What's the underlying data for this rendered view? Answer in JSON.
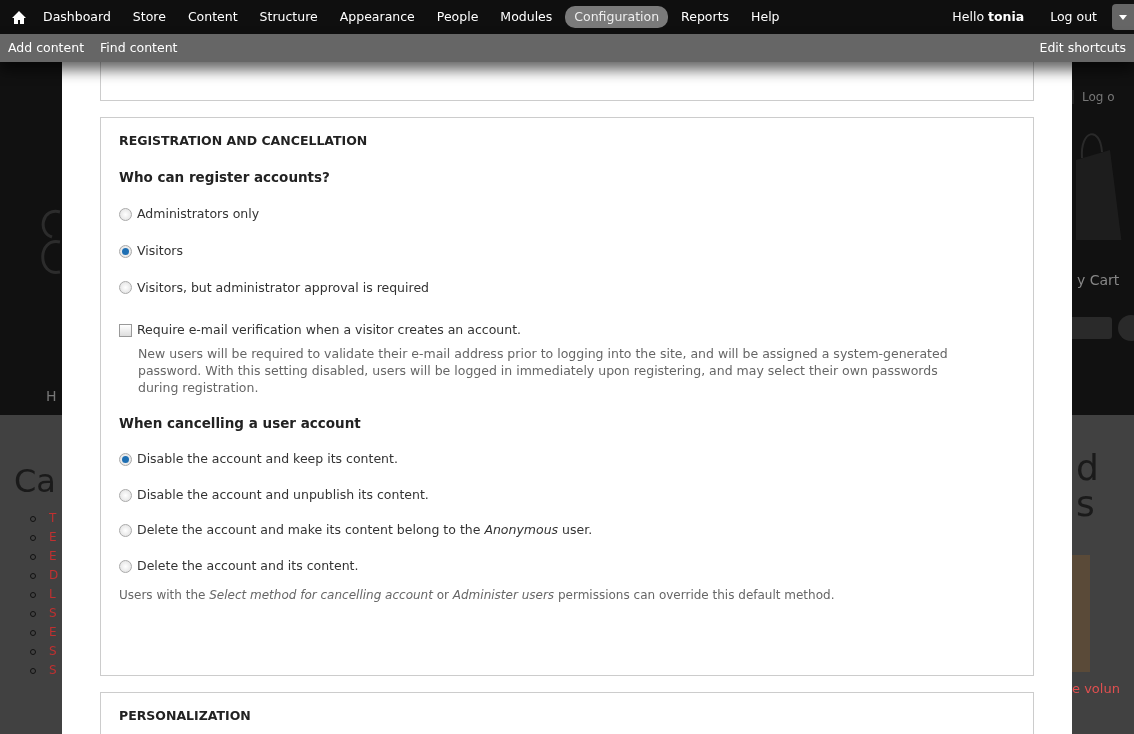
{
  "toolbar": {
    "menu": [
      {
        "label": "Dashboard",
        "selected": false
      },
      {
        "label": "Store",
        "selected": false
      },
      {
        "label": "Content",
        "selected": false
      },
      {
        "label": "Structure",
        "selected": false
      },
      {
        "label": "Appearance",
        "selected": false
      },
      {
        "label": "People",
        "selected": false
      },
      {
        "label": "Modules",
        "selected": false
      },
      {
        "label": "Configuration",
        "selected": true
      },
      {
        "label": "Reports",
        "selected": false
      },
      {
        "label": "Help",
        "selected": false
      }
    ],
    "greeting": "Hello **tonia**",
    "logout": "Log out"
  },
  "shortcuts": {
    "items": [
      "Add content",
      "Find content"
    ],
    "edit": "Edit shortcuts"
  },
  "background": {
    "left_nav": "H",
    "left_heading": "Ca",
    "left_list": [
      "T",
      "E",
      "E",
      "D",
      "L",
      "S",
      "E",
      "S",
      "S"
    ],
    "right_login": "Log o",
    "right_cart": "y Cart",
    "right_heading": [
      "d",
      "s"
    ],
    "right_link": "e volun"
  },
  "registration": {
    "legend": "REGISTRATION AND CANCELLATION",
    "who_label": "Who can register accounts?",
    "who_options": [
      {
        "label": "Administrators only",
        "selected": false
      },
      {
        "label": "Visitors",
        "selected": true
      },
      {
        "label": "Visitors, but administrator approval is required",
        "selected": false
      }
    ],
    "verify": {
      "label": "Require e-mail verification when a visitor creates an account.",
      "checked": false,
      "description": "New users will be required to validate their e-mail address prior to logging into the site, and will be assigned a system-generated password. With this setting disabled, users will be logged in immediately upon registering, and may select their own passwords during registration."
    },
    "cancel_label": "When cancelling a user account",
    "cancel_options": [
      {
        "label": "Disable the account and keep its content.",
        "selected": true
      },
      {
        "label": "Disable the account and unpublish its content.",
        "selected": false
      },
      {
        "label": "Delete the account and make its content belong to the *Anonymous* user.",
        "selected": false
      },
      {
        "label": "Delete the account and its content.",
        "selected": false
      }
    ],
    "help": {
      "before": "Users with the *Select method for cancelling account* or *Administer users*",
      "link": "permissions",
      "after": "can override this default method."
    }
  },
  "personalization": {
    "legend": "PERSONALIZATION"
  }
}
